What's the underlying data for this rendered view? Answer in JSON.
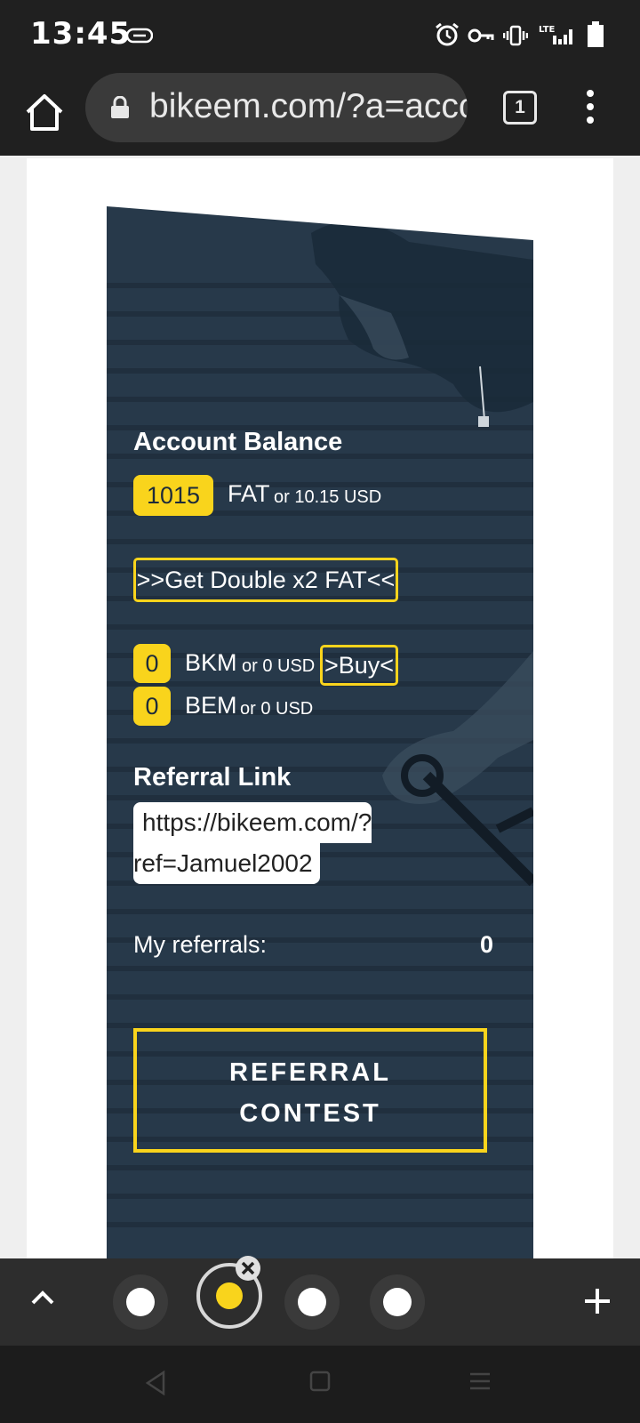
{
  "status_bar": {
    "time": "13:45",
    "network": "LTE",
    "icons": [
      "link-icon",
      "alarm-icon",
      "vpn-key-icon",
      "vibrate-icon",
      "lte-signal-icon",
      "battery-icon"
    ]
  },
  "browser": {
    "url": "bikeem.com/?a=account",
    "tab_count": "1"
  },
  "account": {
    "balance_heading": "Account Balance",
    "fat_amount": "1015",
    "fat_unit": "FAT",
    "fat_usd": "or 10.15 USD",
    "double_button": ">>Get Double x2 FAT<<",
    "bkm_amount": "0",
    "bkm_unit": "BKM",
    "bkm_usd": "or 0 USD",
    "buy_button": ">Buy<",
    "bem_amount": "0",
    "bem_unit": "BEM",
    "bem_usd": "or 0 USD",
    "referral_heading": "Referral Link",
    "referral_link_line1": "https://bikeem.com/?",
    "referral_link_line2": "ref=Jamuel2002",
    "my_referrals_label": "My referrals:",
    "my_referrals_count": "0",
    "contest_line1": "REFERRAL",
    "contest_line2": "CONTEST"
  },
  "colors": {
    "accent": "#f9d41c",
    "card_bg": "#27394a"
  }
}
